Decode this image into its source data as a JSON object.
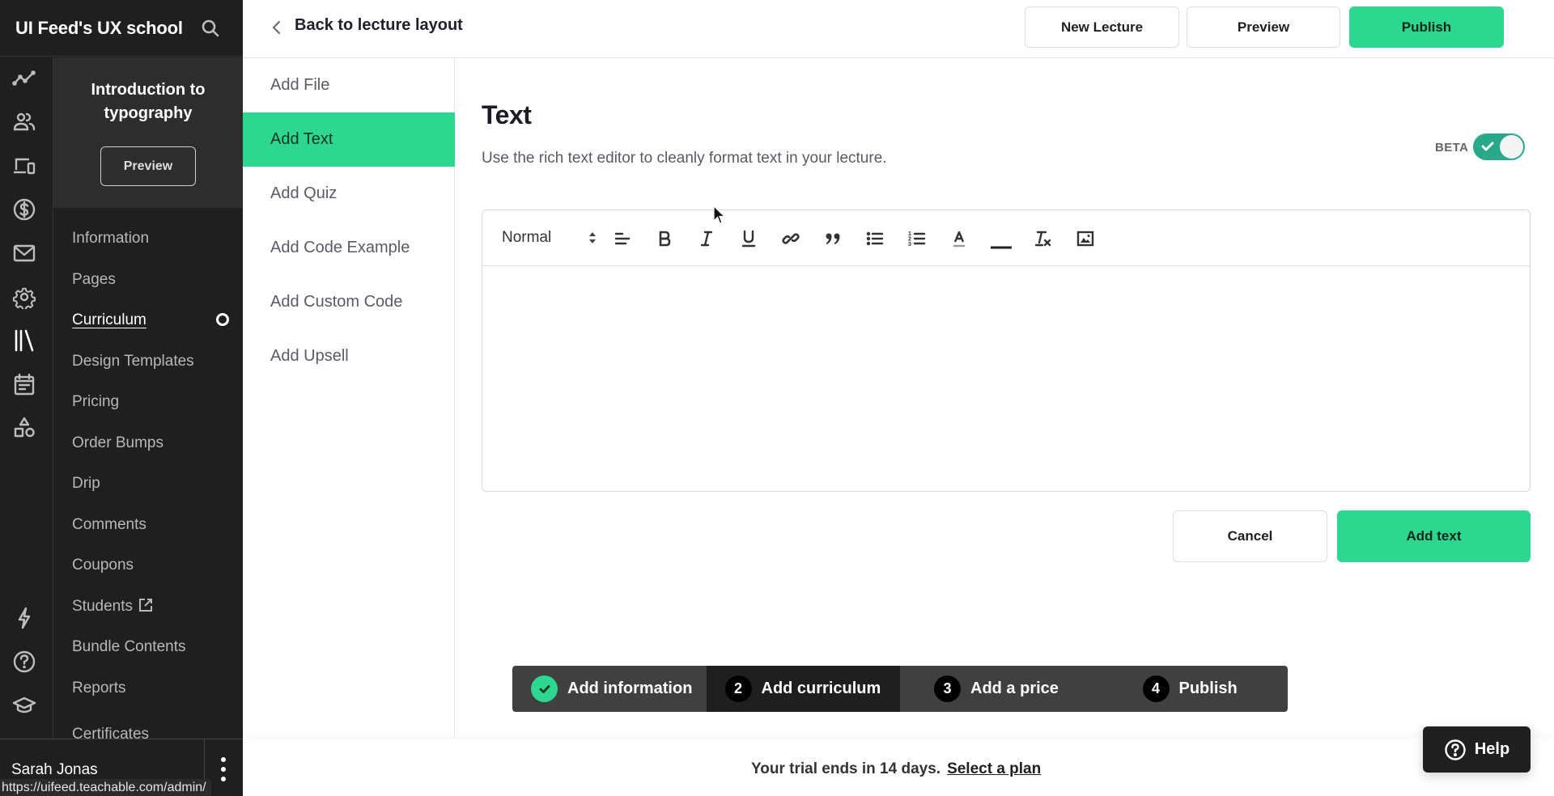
{
  "school": {
    "name": "UI Feed's UX school",
    "search_icon": "search-icon"
  },
  "rail_icons": [
    {
      "name": "analytics-icon"
    },
    {
      "name": "users-icon"
    },
    {
      "name": "devices-icon"
    },
    {
      "name": "sales-dollar-icon"
    },
    {
      "name": "email-icon"
    },
    {
      "name": "settings-gear-icon"
    },
    {
      "name": "library-icon"
    },
    {
      "name": "calendar-icon"
    },
    {
      "name": "shapes-icon"
    },
    {
      "name": "lightning-icon"
    },
    {
      "name": "help-circle-icon"
    },
    {
      "name": "graduation-cap-icon"
    }
  ],
  "course": {
    "title_line1": "Introduction to",
    "title_line2": "typography",
    "preview_label": "Preview"
  },
  "nav": {
    "items": [
      {
        "label": "Information"
      },
      {
        "label": "Pages"
      },
      {
        "label": "Curriculum",
        "active": true
      },
      {
        "label": "Design Templates"
      },
      {
        "label": "Pricing"
      },
      {
        "label": "Order Bumps"
      },
      {
        "label": "Drip"
      },
      {
        "label": "Comments"
      },
      {
        "label": "Coupons"
      },
      {
        "label": "Students",
        "external": true
      },
      {
        "label": "Bundle Contents"
      },
      {
        "label": "Reports"
      },
      {
        "label": "Certificates"
      }
    ]
  },
  "user": {
    "name": "Sarah Jonas"
  },
  "status_bar": {
    "url": "https://uifeed.teachable.com/admin/"
  },
  "topbar": {
    "back_label": "Back to lecture layout",
    "new_lecture_label": "New Lecture",
    "preview_label": "Preview",
    "publish_label": "Publish"
  },
  "submenu": {
    "items": [
      {
        "label": "Add File"
      },
      {
        "label": "Add Text",
        "active": true
      },
      {
        "label": "Add Quiz"
      },
      {
        "label": "Add Code Example"
      },
      {
        "label": "Add Custom Code"
      },
      {
        "label": "Add Upsell"
      }
    ]
  },
  "main": {
    "title": "Text",
    "description": "Use the rich text editor to cleanly format text in your lecture.",
    "beta_label": "BETA",
    "beta_enabled": true,
    "editor": {
      "format_select": "Normal",
      "toolbar": [
        {
          "name": "align-icon"
        },
        {
          "name": "bold-icon"
        },
        {
          "name": "italic-icon"
        },
        {
          "name": "underline-icon"
        },
        {
          "name": "link-icon"
        },
        {
          "name": "blockquote-icon"
        },
        {
          "name": "bullet-list-icon"
        },
        {
          "name": "numbered-list-icon"
        },
        {
          "name": "text-color-icon"
        },
        {
          "name": "horizontal-rule-icon"
        },
        {
          "name": "clear-format-icon"
        },
        {
          "name": "image-icon"
        }
      ],
      "content": ""
    },
    "cancel_label": "Cancel",
    "add_text_label": "Add text"
  },
  "stepper": {
    "steps": [
      {
        "badge": "✓",
        "label": "Add information",
        "state": "done"
      },
      {
        "badge": "2",
        "label": "Add curriculum",
        "state": "current"
      },
      {
        "badge": "3",
        "label": "Add a price",
        "state": "todo"
      },
      {
        "badge": "4",
        "label": "Publish",
        "state": "todo"
      }
    ]
  },
  "footer": {
    "trial_text": "Your trial ends in 14 days.",
    "select_plan_label": "Select a plan"
  },
  "help": {
    "label": "Help"
  },
  "colors": {
    "accent_green": "#2ed790",
    "toggle_teal": "#27a98a",
    "sidebar_dark": "#1f1f1f",
    "course_panel": "#2d2d2d",
    "stepper_bg": "#404040"
  }
}
